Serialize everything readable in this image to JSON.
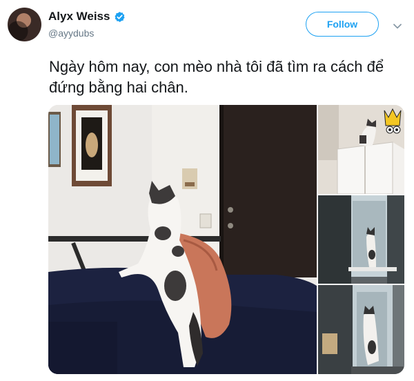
{
  "user": {
    "display_name": "Alyx Weiss",
    "handle": "@ayydubs",
    "verified": true
  },
  "actions": {
    "follow_label": "Follow"
  },
  "tweet": {
    "text": "Ngày hôm nay, con mèo nhà tôi đã tìm ra cách để đứng bằng hai chân."
  },
  "media": {
    "photos": [
      {
        "name": "cat standing on couch"
      },
      {
        "name": "cat on top of cabinet"
      },
      {
        "name": "cat at window"
      },
      {
        "name": "cat standing at window"
      }
    ]
  },
  "icons": {
    "verified": "verified-badge-icon",
    "caret": "chevron-down-icon"
  },
  "colors": {
    "accent": "#1da1f2",
    "text": "#14171a",
    "secondary": "#657786"
  }
}
